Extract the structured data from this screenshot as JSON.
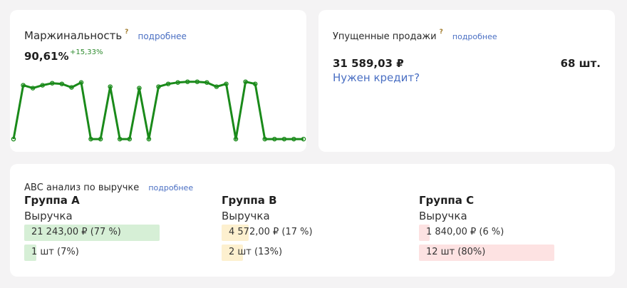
{
  "margin_card": {
    "title": "Маржинальность",
    "help": "?",
    "more_link": "подробнее",
    "value": "90,61%",
    "delta": "+15,33%",
    "line_color": "#1a8a1a",
    "sparkline_levels": [
      0.05,
      0.82,
      0.78,
      0.82,
      0.85,
      0.84,
      0.79,
      0.86,
      0.05,
      0.05,
      0.8,
      0.05,
      0.05,
      0.78,
      0.05,
      0.8,
      0.84,
      0.86,
      0.87,
      0.87,
      0.86,
      0.8,
      0.84,
      0.05,
      0.87,
      0.84,
      0.05,
      0.05,
      0.05,
      0.05,
      0.05
    ]
  },
  "lost_sales_card": {
    "title": "Упущенные продажи",
    "help": "?",
    "more_link": "подробнее",
    "amount": "31 589,03 ₽",
    "count": "68 шт.",
    "credit_link": "Нужен кредит?"
  },
  "abc_card": {
    "title": "АВС анализ по выручке",
    "more_link": "подробнее",
    "groups": [
      {
        "title": "Группа А",
        "revenue_label": "Выручка",
        "revenue_text": "21 243,00 ₽ (77 %)",
        "revenue_share": 1.0,
        "count_text": "1 шт (7%)",
        "count_share": 0.09,
        "color": "#d6efd6"
      },
      {
        "title": "Группа В",
        "revenue_label": "Выручка",
        "revenue_text": "4 572,00 ₽ (17 %)",
        "revenue_share": 0.2,
        "count_text": "2 шт (13%)",
        "count_share": 0.16,
        "color": "#fdf0cf"
      },
      {
        "title": "Группа С",
        "revenue_label": "Выручка",
        "revenue_text": "1 840,00 ₽ (6 %)",
        "revenue_share": 0.08,
        "count_text": "12 шт (80%)",
        "count_share": 1.0,
        "color": "#fde2e2"
      }
    ]
  }
}
